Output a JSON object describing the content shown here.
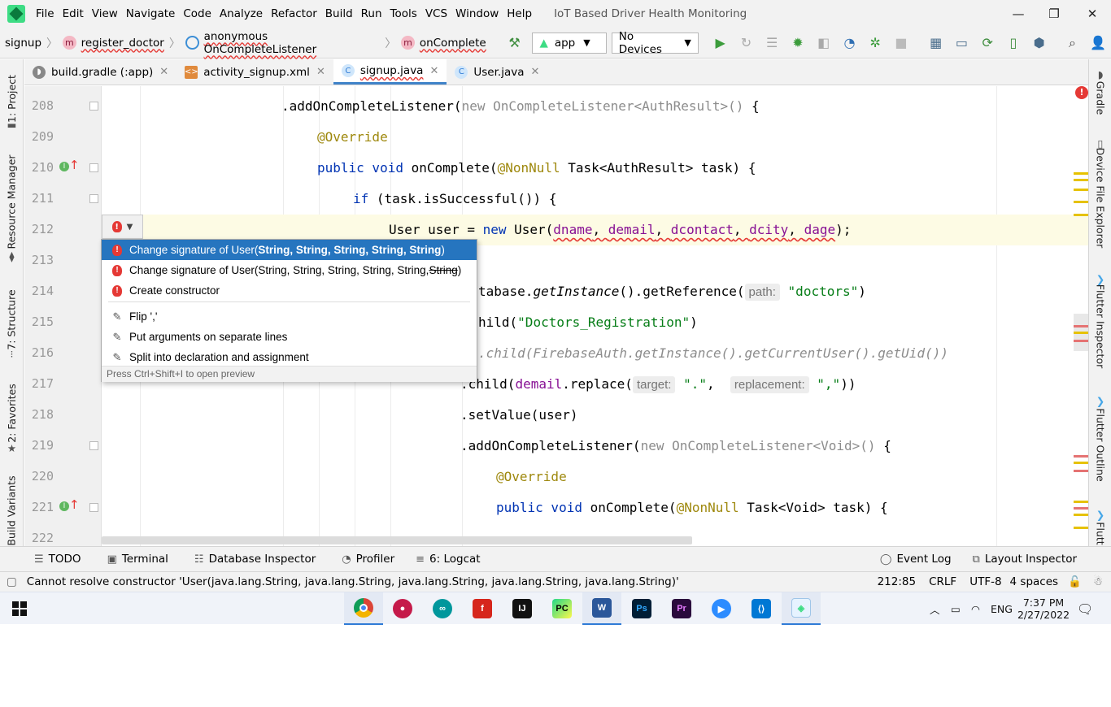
{
  "menubar": {
    "items": [
      "File",
      "Edit",
      "View",
      "Navigate",
      "Code",
      "Analyze",
      "Refactor",
      "Build",
      "Run",
      "Tools",
      "VCS",
      "Window",
      "Help"
    ],
    "window_title": "IoT Based Driver Health Monitoring",
    "controls": {
      "minimize": "—",
      "maximize": "❐",
      "close": "✕"
    }
  },
  "breadcrumb": {
    "project": "signup",
    "method1": "register_doctor",
    "anon": "anonymous OnCompleteListener",
    "method2": "onComplete"
  },
  "toolbar": {
    "config": "app",
    "device": "No Devices"
  },
  "tabs": [
    {
      "label": "build.gradle (:app)",
      "icon": "gradle-icon"
    },
    {
      "label": "activity_signup.xml",
      "icon": "xml-icon"
    },
    {
      "label": "signup.java",
      "icon": "class-icon"
    },
    {
      "label": "User.java",
      "icon": "class-icon"
    }
  ],
  "left_tools": [
    "1: Project",
    "Resource Manager",
    "7: Structure",
    "2: Favorites",
    "Build Variants"
  ],
  "right_tools": [
    "Gradle",
    "Device File Explorer",
    "Flutter Inspector",
    "Flutter Outline",
    "Flutt"
  ],
  "editor": {
    "lines": [
      "208",
      "209",
      "210",
      "211",
      "212",
      "213",
      "214",
      "215",
      "216",
      "217",
      "218",
      "219",
      "220",
      "221",
      "222"
    ],
    "code": {
      "l208_a": ".addOnCompleteListener(",
      "l208_kw": "new",
      "l208_b": " OnCompleteListener<AuthResult>()",
      "l208_c": " {",
      "l209": "@Override",
      "l210_kw": "public void",
      "l210_a": " onComplete(",
      "l210_ann": "@NonNull",
      "l210_b": " Task<AuthResult> task) {",
      "l211_kw": "if",
      "l211_a": " (task.isSuccessful()) {",
      "l212_a": "User user = ",
      "l212_kw": "new",
      "l212_b": " User(",
      "l212_args": [
        "dname",
        "demail",
        "dcontact",
        "dcity",
        "dage"
      ],
      "l212_c": ");",
      "l214_a": "tabase.",
      "l214_m": "getInstance",
      "l214_b": "().getReference(",
      "l214_hint": "path:",
      "l214_str": "\"doctors\"",
      "l214_c": ")",
      "l215_a": "hild(",
      "l215_str": "\"Doctors_Registration\"",
      "l215_c": ")",
      "l216": ".child(FirebaseAuth.getInstance().getCurrentUser().getUid())",
      "l217_a": ".child(",
      "l217_var": "demail",
      "l217_b": ".replace(",
      "l217_hint1": "target:",
      "l217_str1": "\".\"",
      "l217_comma": ",",
      "l217_hint2": "replacement:",
      "l217_str2": "\",\"",
      "l217_c": "))",
      "l218": ".setValue(user)",
      "l219_a": ".addOnCompleteListener(",
      "l219_kw": "new",
      "l219_b": " OnCompleteListener<Void>()",
      "l219_c": " {",
      "l220": "@Override",
      "l221_kw": "public void",
      "l221_a": " onComplete(",
      "l221_ann": "@NonNull",
      "l221_b": " Task<Void> task) {"
    }
  },
  "popup": {
    "item1_prefix": "Change signature of User(",
    "item1_bold": "String, String, String, String, String",
    "item1_suffix": ")",
    "item2_prefix": "Change signature of User(String, String, String, String, String, ",
    "item2_strike": "String",
    "item2_suffix": ")",
    "item3": "Create constructor",
    "item4": "Flip ','",
    "item5": "Put arguments on separate lines",
    "item6": "Split into declaration and assignment",
    "footer": "Press Ctrl+Shift+I to open preview"
  },
  "bottom_tools": {
    "todo": "TODO",
    "terminal": "Terminal",
    "database": "Database Inspector",
    "profiler": "Profiler",
    "logcat": "6: Logcat",
    "eventlog": "Event Log",
    "layout": "Layout Inspector"
  },
  "status": {
    "message": "Cannot resolve constructor 'User(java.lang.String, java.lang.String, java.lang.String, java.lang.String, java.lang.String)'",
    "position": "212:85",
    "line_sep": "CRLF",
    "encoding": "UTF-8",
    "indent": "4 spaces"
  },
  "taskbar": {
    "lang": "ENG",
    "time": "7:37 PM",
    "date": "2/27/2022"
  },
  "colors": {
    "accent": "#2675bf",
    "error": "#e53935",
    "keyword": "#0033b3",
    "annotation": "#9e880d",
    "string": "#067d17"
  }
}
